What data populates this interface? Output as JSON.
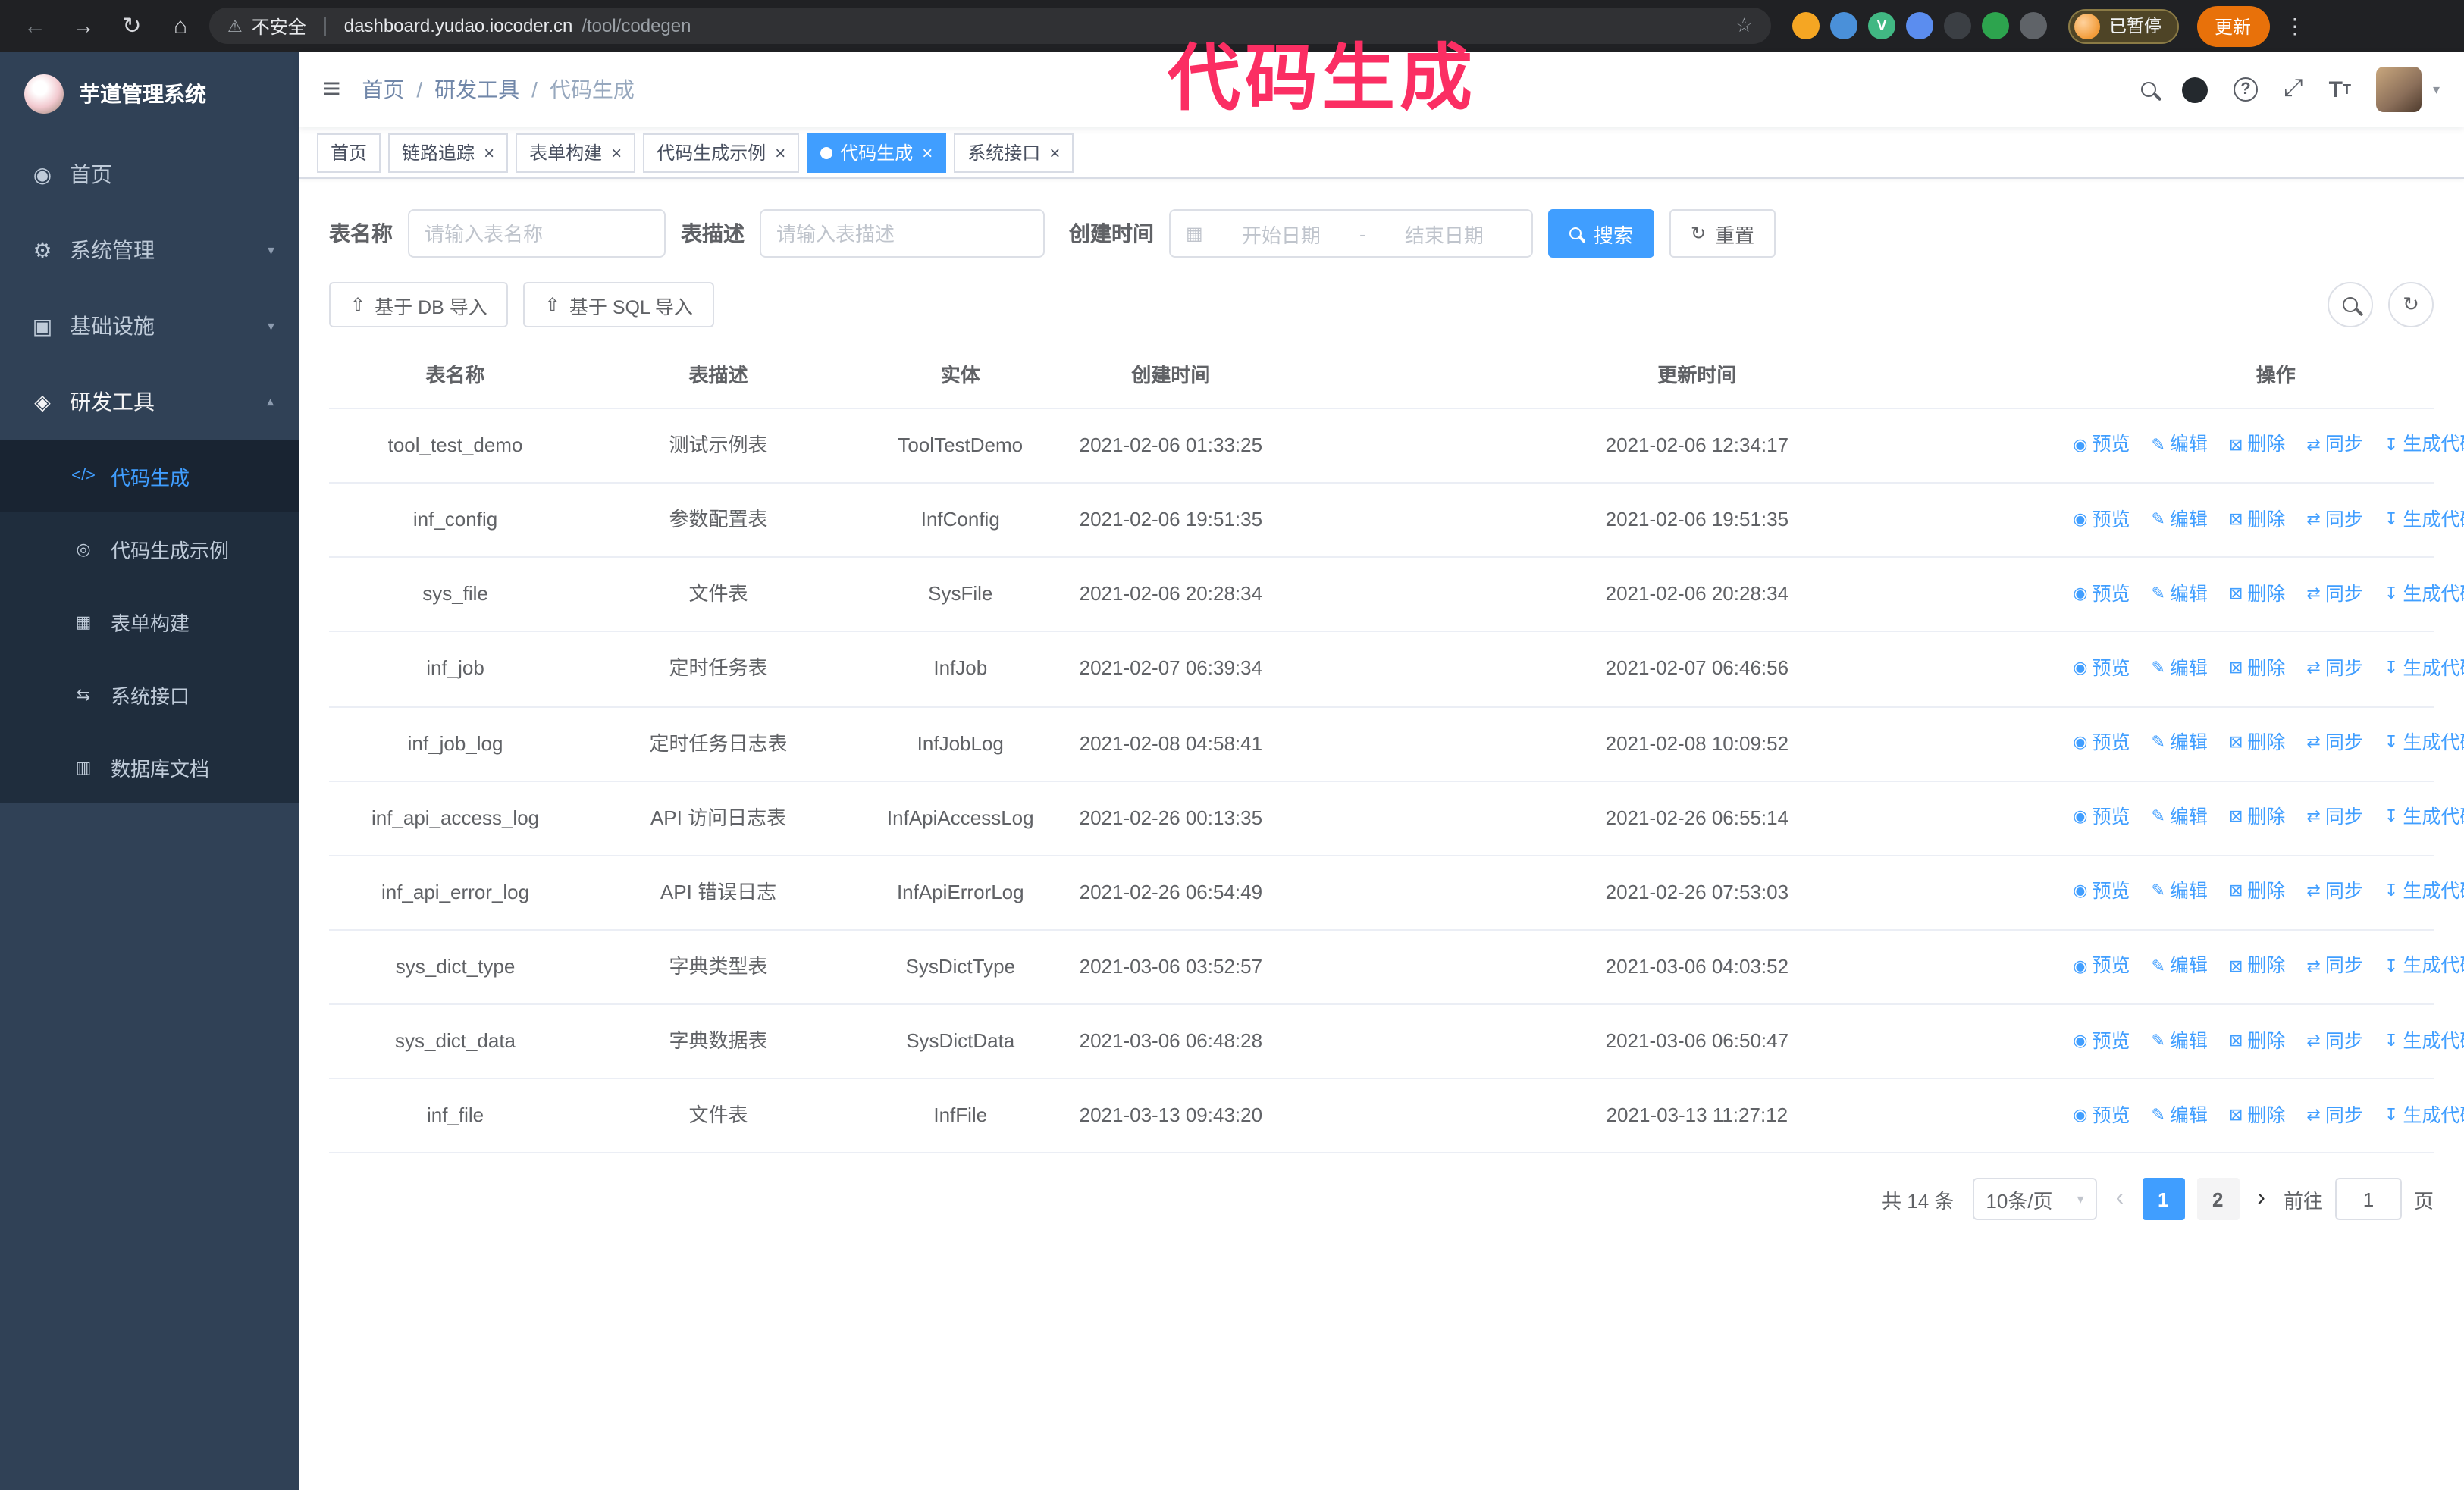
{
  "colors": {
    "accent": "#409eff",
    "sidebarBg": "#304156",
    "submenuBg": "#1f2d3d",
    "chromeBg": "#202124",
    "updateBg": "#e8710a",
    "annotation": "#fb2e63"
  },
  "annotation": {
    "text": "代码生成"
  },
  "browser": {
    "nav": {
      "back": "←",
      "forward": "→",
      "reload": "↻",
      "home": "⌂",
      "warning": "⚠",
      "star": "☆",
      "menu": "⋮"
    },
    "security_label": "不安全",
    "url_domain": "dashboard.yudao.iocoder.cn",
    "url_path": "/tool/codegen",
    "extensions": [
      {
        "name": "extension-orange",
        "bg": "#f5a623",
        "label": ""
      },
      {
        "name": "extension-blue-drop",
        "bg": "#4a90d9",
        "label": ""
      },
      {
        "name": "vue-devtools",
        "bg": "#41b883",
        "label": "V"
      },
      {
        "name": "extension-people",
        "bg": "#5b8def",
        "label": ""
      },
      {
        "name": "extension-dark",
        "bg": "#3b3f44",
        "label": ""
      },
      {
        "name": "extension-green",
        "bg": "#2da44e",
        "label": ""
      },
      {
        "name": "extensions-puzzle",
        "bg": "#5f6368",
        "label": ""
      }
    ],
    "profile_badge": "已暂停",
    "update_button": "更新"
  },
  "sidebar": {
    "logo_title": "芋道管理系统",
    "items": [
      {
        "label": "首页",
        "icon": "dashboard-icon",
        "icon_glyph": "◉",
        "expandable": false,
        "expanded": false
      },
      {
        "label": "系统管理",
        "icon": "gear-icon",
        "icon_glyph": "⚙",
        "expandable": true,
        "expanded": false
      },
      {
        "label": "基础设施",
        "icon": "infrastructure-icon",
        "icon_glyph": "▣",
        "expandable": true,
        "expanded": false
      },
      {
        "label": "研发工具",
        "icon": "dev-tools-icon",
        "icon_glyph": "◈",
        "expandable": true,
        "expanded": true
      }
    ],
    "subitems": [
      {
        "label": "代码生成",
        "icon": "code-icon",
        "icon_glyph": "</>",
        "active": true
      },
      {
        "label": "代码生成示例",
        "icon": "demo-icon",
        "icon_glyph": "◎",
        "active": false
      },
      {
        "label": "表单构建",
        "icon": "form-icon",
        "icon_glyph": "▦",
        "active": false
      },
      {
        "label": "系统接口",
        "icon": "api-icon",
        "icon_glyph": "⇆",
        "active": false
      },
      {
        "label": "数据库文档",
        "icon": "database-icon",
        "icon_glyph": "▥",
        "active": false
      }
    ]
  },
  "header": {
    "hamburger_glyph": "≡",
    "breadcrumb": [
      "首页",
      "研发工具",
      "代码生成"
    ],
    "help_glyph": "?",
    "fullscreen_glyph": "⤢",
    "caret_glyph": "▾"
  },
  "tabs": [
    {
      "label": "首页",
      "closable": false,
      "active": false
    },
    {
      "label": "链路追踪",
      "closable": true,
      "active": false
    },
    {
      "label": "表单构建",
      "closable": true,
      "active": false
    },
    {
      "label": "代码生成示例",
      "closable": true,
      "active": false
    },
    {
      "label": "代码生成",
      "closable": true,
      "active": true
    },
    {
      "label": "系统接口",
      "closable": true,
      "active": false
    }
  ],
  "filters": {
    "table_name_label": "表名称",
    "table_name_placeholder": "请输入表名称",
    "table_desc_label": "表描述",
    "table_desc_placeholder": "请输入表描述",
    "create_time_label": "创建时间",
    "calendar_glyph": "▦",
    "date_start_placeholder": "开始日期",
    "date_separator": "-",
    "date_end_placeholder": "结束日期",
    "search_button": "搜索",
    "reset_button": "重置",
    "reset_glyph": "↻"
  },
  "toolbar": {
    "import_db": "基于 DB 导入",
    "import_sql": "基于 SQL 导入",
    "import_glyph": "⇧",
    "refresh_glyph": "↻"
  },
  "table": {
    "columns": [
      "表名称",
      "表描述",
      "实体",
      "创建时间",
      "更新时间",
      "操作"
    ],
    "actions": [
      "预览",
      "编辑",
      "删除",
      "同步",
      "生成代码"
    ],
    "action_icons": [
      "◉",
      "✎",
      "⊠",
      "⇄",
      "↧"
    ],
    "rows": [
      {
        "name": "tool_test_demo",
        "desc": "测试示例表",
        "entity": "ToolTestDemo",
        "created": "2021-02-06 01:33:25",
        "updated": "2021-02-06 12:34:17"
      },
      {
        "name": "inf_config",
        "desc": "参数配置表",
        "entity": "InfConfig",
        "created": "2021-02-06 19:51:35",
        "updated": "2021-02-06 19:51:35"
      },
      {
        "name": "sys_file",
        "desc": "文件表",
        "entity": "SysFile",
        "created": "2021-02-06 20:28:34",
        "updated": "2021-02-06 20:28:34"
      },
      {
        "name": "inf_job",
        "desc": "定时任务表",
        "entity": "InfJob",
        "created": "2021-02-07 06:39:34",
        "updated": "2021-02-07 06:46:56"
      },
      {
        "name": "inf_job_log",
        "desc": "定时任务日志表",
        "entity": "InfJobLog",
        "created": "2021-02-08 04:58:41",
        "updated": "2021-02-08 10:09:52"
      },
      {
        "name": "inf_api_access_log",
        "desc": "API 访问日志表",
        "entity": "InfApiAccessLog",
        "created": "2021-02-26 00:13:35",
        "updated": "2021-02-26 06:55:14"
      },
      {
        "name": "inf_api_error_log",
        "desc": "API 错误日志",
        "entity": "InfApiErrorLog",
        "created": "2021-02-26 06:54:49",
        "updated": "2021-02-26 07:53:03"
      },
      {
        "name": "sys_dict_type",
        "desc": "字典类型表",
        "entity": "SysDictType",
        "created": "2021-03-06 03:52:57",
        "updated": "2021-03-06 04:03:52"
      },
      {
        "name": "sys_dict_data",
        "desc": "字典数据表",
        "entity": "SysDictData",
        "created": "2021-03-06 06:48:28",
        "updated": "2021-03-06 06:50:47"
      },
      {
        "name": "inf_file",
        "desc": "文件表",
        "entity": "InfFile",
        "created": "2021-03-13 09:43:20",
        "updated": "2021-03-13 11:27:12"
      }
    ]
  },
  "pagination": {
    "total": "共 14 条",
    "page_size": "10条/页",
    "prev_glyph": "‹",
    "next_glyph": "›",
    "pages": [
      "1",
      "2"
    ],
    "goto_label": "前往",
    "goto_value": "1",
    "page_suffix": "页"
  }
}
